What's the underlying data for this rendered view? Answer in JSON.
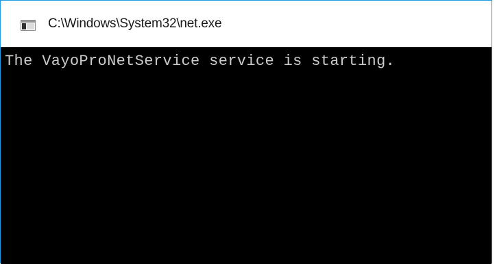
{
  "window": {
    "title": "C:\\Windows\\System32\\net.exe",
    "icon": "console-window-icon",
    "border_color": "#1e9be4"
  },
  "console": {
    "background_color": "#000000",
    "text_color": "#cccccc",
    "lines": [
      "The VayoProNetService service is starting."
    ]
  }
}
